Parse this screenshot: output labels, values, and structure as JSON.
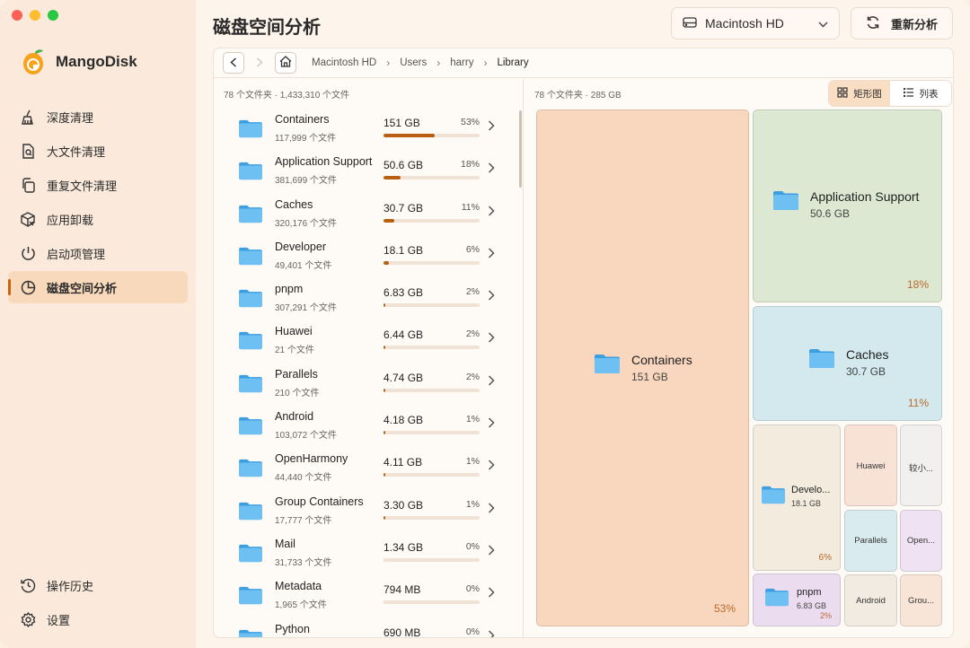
{
  "app": {
    "name": "MangoDisk",
    "page_title": "磁盘空间分析"
  },
  "colors": {
    "accent": "#c8640e",
    "folder": "#5ab2ea"
  },
  "sidebar": {
    "items": [
      {
        "label": "深度清理",
        "icon": "broom-icon"
      },
      {
        "label": "大文件清理",
        "icon": "file-search-icon"
      },
      {
        "label": "重复文件清理",
        "icon": "copy-icon"
      },
      {
        "label": "应用卸载",
        "icon": "package-remove-icon"
      },
      {
        "label": "启动项管理",
        "icon": "power-icon"
      },
      {
        "label": "磁盘空间分析",
        "icon": "pie-chart-icon",
        "active": true
      }
    ],
    "bottom": [
      {
        "label": "操作历史",
        "icon": "history-icon"
      },
      {
        "label": "设置",
        "icon": "gear-icon"
      }
    ]
  },
  "header": {
    "drive": "Macintosh HD",
    "rescan_label": "重新分析"
  },
  "breadcrumb": [
    "Macintosh HD",
    "Users",
    "harry",
    "Library"
  ],
  "list": {
    "summary": "78 个文件夹 · 1,433,310 个文件",
    "rows": [
      {
        "name": "Containers",
        "count": "117,999 个文件",
        "size": "151 GB",
        "pct": "53%",
        "frac": 0.53
      },
      {
        "name": "Application Support",
        "count": "381,699 个文件",
        "size": "50.6 GB",
        "pct": "18%",
        "frac": 0.18
      },
      {
        "name": "Caches",
        "count": "320,176 个文件",
        "size": "30.7 GB",
        "pct": "11%",
        "frac": 0.11
      },
      {
        "name": "Developer",
        "count": "49,401 个文件",
        "size": "18.1 GB",
        "pct": "6%",
        "frac": 0.06
      },
      {
        "name": "pnpm",
        "count": "307,291 个文件",
        "size": "6.83 GB",
        "pct": "2%",
        "frac": 0.02
      },
      {
        "name": "Huawei",
        "count": "21 个文件",
        "size": "6.44 GB",
        "pct": "2%",
        "frac": 0.02
      },
      {
        "name": "Parallels",
        "count": "210 个文件",
        "size": "4.74 GB",
        "pct": "2%",
        "frac": 0.02
      },
      {
        "name": "Android",
        "count": "103,072 个文件",
        "size": "4.18 GB",
        "pct": "1%",
        "frac": 0.01
      },
      {
        "name": "OpenHarmony",
        "count": "44,440 个文件",
        "size": "4.11 GB",
        "pct": "1%",
        "frac": 0.01
      },
      {
        "name": "Group Containers",
        "count": "17,777 个文件",
        "size": "3.30 GB",
        "pct": "1%",
        "frac": 0.01
      },
      {
        "name": "Mail",
        "count": "31,733 个文件",
        "size": "1.34 GB",
        "pct": "0%",
        "frac": 0.0
      },
      {
        "name": "Metadata",
        "count": "1,965 个文件",
        "size": "794 MB",
        "pct": "0%",
        "frac": 0.0
      },
      {
        "name": "Python",
        "count": "",
        "size": "690 MB",
        "pct": "0%",
        "frac": 0.0
      }
    ]
  },
  "treemap": {
    "summary": "78 个文件夹 · 285 GB",
    "view_tabs": [
      "矩形图",
      "列表"
    ],
    "tiles": [
      {
        "name": "Containers",
        "size": "151 GB",
        "pct": "53%",
        "color": "#f9d7bf"
      },
      {
        "name": "Application Support",
        "size": "50.6 GB",
        "pct": "18%",
        "color": "#dde8d2"
      },
      {
        "name": "Caches",
        "size": "30.7 GB",
        "pct": "11%",
        "color": "#d3e9ee"
      },
      {
        "name": "Develo...",
        "size": "18.1 GB",
        "pct": "6%",
        "color": "#f3ebdd"
      },
      {
        "name": "pnpm",
        "size": "6.83 GB",
        "pct": "2%",
        "color": "#ecdcef"
      },
      {
        "name": "Huawei",
        "color": "#f8e2d6"
      },
      {
        "name": "较小...",
        "color": "#f2f0ee"
      },
      {
        "name": "Parallels",
        "color": "#d9ebef"
      },
      {
        "name": "Open...",
        "color": "#efe2f2"
      },
      {
        "name": "Android",
        "color": "#f1ebe2"
      },
      {
        "name": "Grou...",
        "color": "#f9e4d8"
      }
    ]
  }
}
